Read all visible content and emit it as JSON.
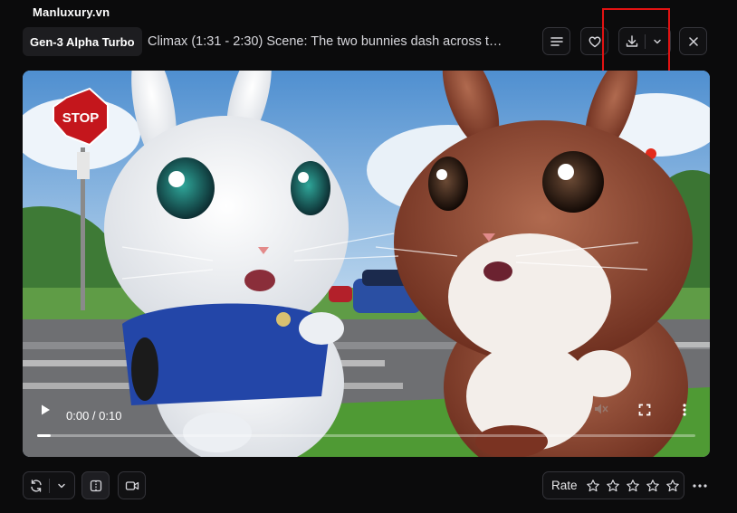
{
  "watermark": "Manluxury.vn",
  "header": {
    "model": "Gen-3 Alpha Turbo",
    "title": "Climax (1:31 - 2:30) Scene: The two bunnies dash across t…",
    "buttons": [
      "details-icon",
      "heart-icon",
      "download-icon",
      "chevron-down-icon",
      "close-icon"
    ]
  },
  "video": {
    "current_time": "0:00",
    "duration": "0:10",
    "time_display": "0:00 / 0:10",
    "progress": 0.02,
    "sign_text": "STOP"
  },
  "footer": {
    "rate_label": "Rate",
    "stars_total": 5,
    "stars_selected": 0
  },
  "colors": {
    "background": "#0b0b0c",
    "border": "#34343a",
    "highlight": "#e11212"
  }
}
